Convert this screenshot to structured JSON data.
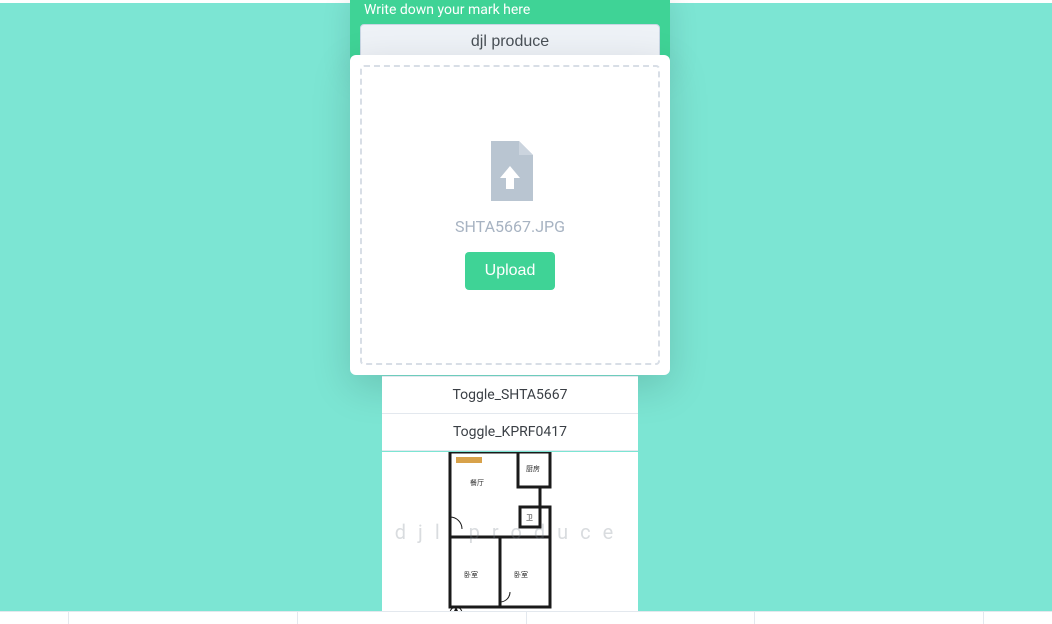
{
  "header": {
    "prompt": "Write down your mark here",
    "mark_value": "djl produce"
  },
  "upload": {
    "filename": "SHTA5667.JPG",
    "button_label": "Upload"
  },
  "toggles": [
    {
      "label": "Toggle_SHTA5667"
    },
    {
      "label": "Toggle_KPRF0417"
    }
  ],
  "floorplan": {
    "rooms": {
      "dining": "餐厅",
      "kitchen": "厨房",
      "bath": "卫",
      "bedroom1": "卧室",
      "bedroom2": "卧室"
    },
    "watermark": "djl produce"
  },
  "colors": {
    "mint": "#7ce5d3",
    "green": "#3fd396",
    "muted": "#a7b3c2"
  }
}
